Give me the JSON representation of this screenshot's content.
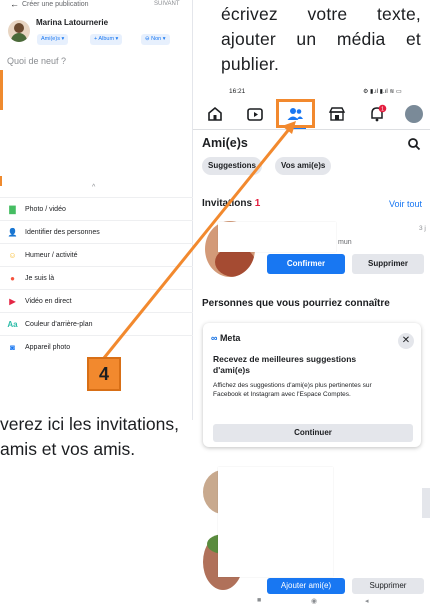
{
  "left_screen": {
    "back_glyph": "←",
    "title": "Créer une publication",
    "next_label": "SUIVANT",
    "user_name": "Marina Latournerie",
    "chips": [
      "Ami(e)s ▾",
      "+ Album ▾",
      "⊖ Non ▾"
    ],
    "placeholder": "Quoi de neuf ?",
    "drag_handle": "^",
    "options": [
      {
        "label": "Photo / vidéo",
        "icon": "photo-icon",
        "color": "#45bd62",
        "glyph": "▇"
      },
      {
        "label": "Identifier des personnes",
        "icon": "tag-people-icon",
        "color": "#1877f2",
        "glyph": "👤"
      },
      {
        "label": "Humeur / activité",
        "icon": "feeling-icon",
        "color": "#f7b928",
        "glyph": "☺"
      },
      {
        "label": "Je suis là",
        "icon": "checkin-icon",
        "color": "#f5533d",
        "glyph": "●"
      },
      {
        "label": "Vidéo en direct",
        "icon": "live-video-icon",
        "color": "#e42645",
        "glyph": "▶"
      },
      {
        "label": "Couleur d'arrière-plan",
        "icon": "background-color-icon",
        "color": "#2abba7",
        "glyph": "Aa"
      },
      {
        "label": "Appareil photo",
        "icon": "camera-icon",
        "color": "#1877f2",
        "glyph": "◙"
      }
    ]
  },
  "instruction_top": "écrivez votre texte, ajouter un média et publier.",
  "instruction_bottom": "verez ici les invitations, amis et vos amis.",
  "step_badge": "4",
  "right_screen": {
    "time": "16:21",
    "status_icons": "⚙ ▮.ıl ▮.ıl ≋ ▭",
    "page_title": "Ami(e)s",
    "pills": [
      "Suggestions",
      "Vos ami(e)s"
    ],
    "invitations_label": "Invitations",
    "invitations_count": "1",
    "see_all": "Voir tout",
    "mutual_text": "mun",
    "days_text": "3 j",
    "confirm_label": "Confirmer",
    "delete_label": "Supprimer",
    "suggestions_title": "Personnes que vous pourriez connaître",
    "meta_card": {
      "logo_text": "Meta",
      "logo_symbol": "∞",
      "headline": "Recevez de meilleures suggestions d'ami(e)s",
      "body": "Affichez des suggestions d'ami(e)s plus pertinentes sur Facebook et Instagram avec l'Espace Comptes.",
      "button": "Continuer",
      "close_glyph": "✕"
    },
    "add_friend_label": "Ajouter ami(e)",
    "delete2_label": "Supprimer",
    "notification_badge": "1",
    "sysnav": [
      "■",
      "◉",
      "◂"
    ]
  },
  "colors": {
    "accent": "#f2892e",
    "fb_blue": "#1877f2"
  }
}
